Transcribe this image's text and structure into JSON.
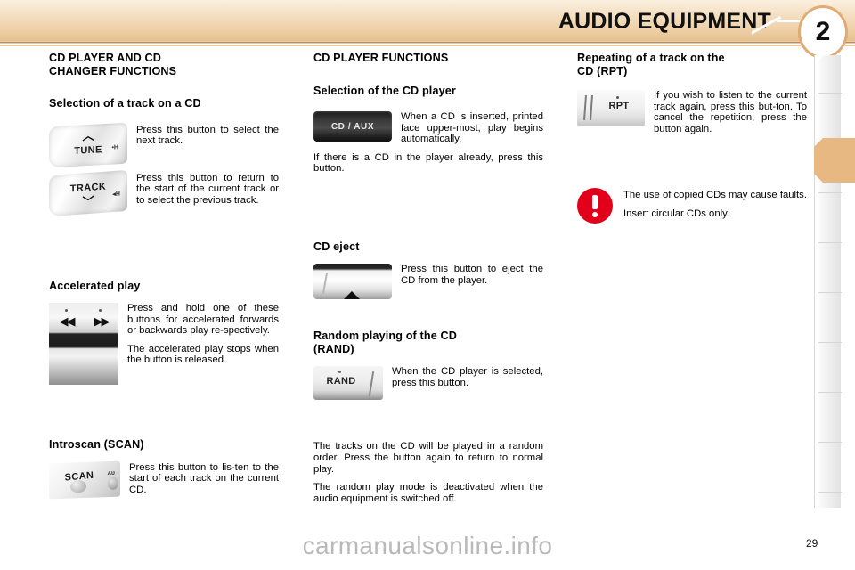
{
  "header": {
    "title": "AUDIO EQUIPMENT",
    "chapter_number": "2",
    "accent_color": "#e8b882",
    "band_color": "#eecfa5"
  },
  "column_1": {
    "section_title_line1": "CD PLAYER AND CD",
    "section_title_line2": "CHANGER FUNCTIONS",
    "subsection_1": "Selection of a track on a CD",
    "tune_button_label": "TUNE",
    "tune_button_mini": "•H",
    "tune_text": "Press this button to select the next track.",
    "track_button_label": "TRACK",
    "track_button_mini": "◂H",
    "track_text": "Press this button to return to the start of the current track or to select the previous track.",
    "subsection_2": "Accelerated play",
    "accelerated_text_1": "Press and hold one of these buttons for accelerated forwards or backwards play re-spectively.",
    "accelerated_text_2": "The accelerated play stops when the button is released.",
    "rewind_icon": "◀◀",
    "forward_icon": "▶▶",
    "subsection_3": "Introscan (SCAN)",
    "scan_button_label": "SCAN",
    "scan_text": "Press this button to lis-ten to the start of each track on the current CD."
  },
  "column_2": {
    "section_title": "CD PLAYER FUNCTIONS",
    "subsection_1": "Selection of the CD player",
    "cdaux_button_label": "CD / AUX",
    "cdaux_text_1": "When a CD is inserted, printed face upper-most, play begins automatically.",
    "cdaux_text_2": "If there is a CD in the player already, press this button.",
    "subsection_2": "CD eject",
    "eject_text": "Press this button to eject the CD from the player.",
    "subsection_3_line1": "Random playing of the CD",
    "subsection_3_line2": "(RAND)",
    "rand_button_label": "RAND",
    "rand_text": "When the CD player is selected, press this button.",
    "rand_text_2": "The tracks on the CD will be played in a random order. Press the button again to return to normal play.",
    "rand_text_3": "The random play mode is deactivated when the audio equipment is switched off."
  },
  "column_3": {
    "section_title_line1": "Repeating of a track on the",
    "section_title_line2": "CD (RPT)",
    "rpt_button_label": "RPT",
    "rpt_text": "If you wish to listen to the current track again, press this but-ton. To cancel the repetition, press the button again.",
    "warning_text_1": "The use of copied CDs may cause faults.",
    "warning_text_2": "Insert circular CDs only.",
    "warning_color": "#e2001a"
  },
  "footer": {
    "page_number": "29",
    "watermark": "carmanualsonline.info"
  }
}
